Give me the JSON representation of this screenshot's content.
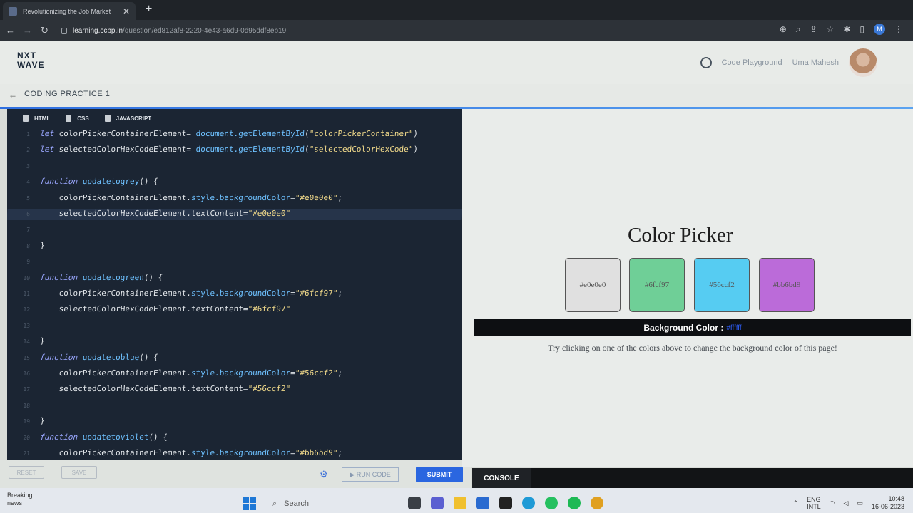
{
  "browser": {
    "tab_title": "Revolutionizing the Job Market",
    "tab_close": "✕",
    "new_tab": "+",
    "url_host": "learning.ccbp.in",
    "url_path": "/question/ed812af8-2220-4e43-a6d9-0d95ddf8eb19",
    "profile_initial": "M"
  },
  "header": {
    "logo_line1": "NXT",
    "logo_line2": "WAVE",
    "playground": "Code Playground",
    "user_name": "Uma Mahesh",
    "back_arrow": "←",
    "practice_title": "CODING PRACTICE 1"
  },
  "editor": {
    "tabs": [
      "HTML",
      "CSS",
      "JAVASCRIPT"
    ],
    "lines": [
      {
        "n": "1",
        "kw": "let ",
        "a": "colorPickerContainerElement= ",
        "fn": "document.getElementById",
        "p": "(",
        "s": "\"colorPickerContainer\"",
        "e": ")"
      },
      {
        "n": "2",
        "kw": "let ",
        "a": "selectedColorHexCodeElement= ",
        "fn": "document.getElementById",
        "p": "(",
        "s": "\"selectedColorHexCode\"",
        "e": ")"
      },
      {
        "n": "3",
        "kw": "",
        "a": "",
        "fn": "",
        "p": "",
        "s": "",
        "e": ""
      },
      {
        "n": "4",
        "kw": "function ",
        "a": "",
        "fn": "updatetogrey",
        "p": "() {",
        "s": "",
        "e": ""
      },
      {
        "n": "5",
        "kw": "",
        "a": "    colorPickerContainerElement.",
        "fn": "style.backgroundColor",
        "p": "=",
        "s": "\"#e0e0e0\"",
        "e": ";"
      },
      {
        "n": "6",
        "kw": "",
        "a": "    selectedColorHexCodeElement.textContent=",
        "fn": "",
        "p": "",
        "s": "\"#e0e0e0\"",
        "e": ""
      },
      {
        "n": "7",
        "kw": "",
        "a": "",
        "fn": "",
        "p": "",
        "s": "",
        "e": ""
      },
      {
        "n": "8",
        "kw": "",
        "a": "}",
        "fn": "",
        "p": "",
        "s": "",
        "e": ""
      },
      {
        "n": "9",
        "kw": "",
        "a": "",
        "fn": "",
        "p": "",
        "s": "",
        "e": ""
      },
      {
        "n": "10",
        "kw": "function ",
        "a": "",
        "fn": "updatetogreen",
        "p": "() {",
        "s": "",
        "e": ""
      },
      {
        "n": "11",
        "kw": "",
        "a": "    colorPickerContainerElement.",
        "fn": "style.backgroundColor",
        "p": "=",
        "s": "\"#6fcf97\"",
        "e": ";"
      },
      {
        "n": "12",
        "kw": "",
        "a": "    selectedColorHexCodeElement.textContent=",
        "fn": "",
        "p": "",
        "s": "\"#6fcf97\"",
        "e": ""
      },
      {
        "n": "13",
        "kw": "",
        "a": "",
        "fn": "",
        "p": "",
        "s": "",
        "e": ""
      },
      {
        "n": "14",
        "kw": "",
        "a": "}",
        "fn": "",
        "p": "",
        "s": "",
        "e": ""
      },
      {
        "n": "15",
        "kw": "function ",
        "a": "",
        "fn": "updatetoblue",
        "p": "() {",
        "s": "",
        "e": ""
      },
      {
        "n": "16",
        "kw": "",
        "a": "    colorPickerContainerElement.",
        "fn": "style.backgroundColor",
        "p": "=",
        "s": "\"#56ccf2\"",
        "e": ";"
      },
      {
        "n": "17",
        "kw": "",
        "a": "    selectedColorHexCodeElement.textContent=",
        "fn": "",
        "p": "",
        "s": "\"#56ccf2\"",
        "e": ""
      },
      {
        "n": "18",
        "kw": "",
        "a": "",
        "fn": "",
        "p": "",
        "s": "",
        "e": ""
      },
      {
        "n": "19",
        "kw": "",
        "a": "}",
        "fn": "",
        "p": "",
        "s": "",
        "e": ""
      },
      {
        "n": "20",
        "kw": "function ",
        "a": "",
        "fn": "updatetoviolet",
        "p": "() {",
        "s": "",
        "e": ""
      },
      {
        "n": "21",
        "kw": "",
        "a": "    colorPickerContainerElement.",
        "fn": "style.backgroundColor",
        "p": "=",
        "s": "\"#bb6bd9\"",
        "e": ";"
      }
    ],
    "reset": "RESET",
    "save": "SAVE",
    "run": "▶ RUN CODE",
    "submit": "SUBMIT"
  },
  "preview": {
    "title": "Color Picker",
    "swatches": [
      {
        "label": "#e0e0e0",
        "color": "#e0e0e0"
      },
      {
        "label": "#6fcf97",
        "color": "#6fcf97"
      },
      {
        "label": "#56ccf2",
        "color": "#56ccf2"
      },
      {
        "label": "#bb6bd9",
        "color": "#bb6bd9"
      }
    ],
    "bg_label": "Background Color :",
    "bg_value": "#ffffff",
    "hint": "Try clicking on one of the colors above to change the background color of this page!"
  },
  "console": {
    "label": "CONSOLE"
  },
  "taskbar": {
    "news_line1": "Breaking",
    "news_line2": "news",
    "search_placeholder": "Search",
    "lang_line1": "ENG",
    "lang_line2": "INTL",
    "time": "10:48",
    "date": "16-06-2023"
  }
}
